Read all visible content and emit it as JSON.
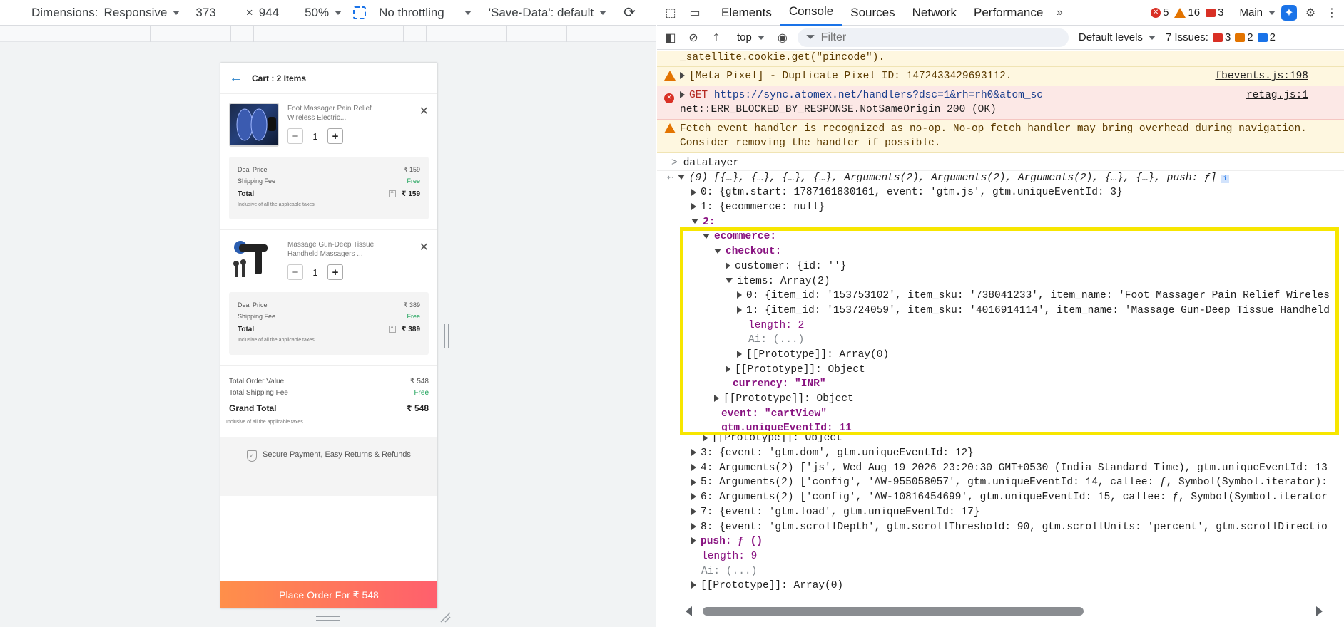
{
  "device_toolbar": {
    "dimensions_label": "Dimensions:",
    "dimensions_value": "Responsive",
    "width": "373",
    "times": "×",
    "height": "944",
    "zoom": "50%",
    "throttling": "No throttling",
    "save_data": "'Save-Data': default"
  },
  "cart": {
    "title": "Cart : 2 Items",
    "items": [
      {
        "name": "Foot Massager Pain Relief Wireless Electric...",
        "qty": "1",
        "deal_price_label": "Deal Price",
        "deal_price": "₹ 159",
        "shipping_label": "Shipping Fee",
        "shipping": "Free",
        "total_label": "Total",
        "total": "₹ 159",
        "incl": "Inclusive of all the applicable taxes"
      },
      {
        "name": "Massage Gun-Deep Tissue Handheld Massagers ...",
        "qty": "1",
        "deal_price_label": "Deal Price",
        "deal_price": "₹ 389",
        "shipping_label": "Shipping Fee",
        "shipping": "Free",
        "total_label": "Total",
        "total": "₹ 389",
        "incl": "Inclusive of all the applicable taxes"
      }
    ],
    "summary": {
      "order_value_label": "Total Order Value",
      "order_value": "₹ 548",
      "shipping_label": "Total Shipping Fee",
      "shipping": "Free",
      "grand_label": "Grand Total",
      "grand": "₹ 548",
      "incl": "Inclusive of all the applicable taxes"
    },
    "secure": "Secure Payment, Easy Returns & Refunds",
    "place_order": "Place Order For ₹ 548"
  },
  "devtools": {
    "tabs": [
      "Elements",
      "Console",
      "Sources",
      "Network",
      "Performance"
    ],
    "active_tab": "Console",
    "errors": "5",
    "warnings": "16",
    "issues_count": "3",
    "main": "Main",
    "context": "top",
    "filter_placeholder": "Filter",
    "levels": "Default levels",
    "issues_label": "7 Issues:",
    "issues_err": "3",
    "issues_warn": "2",
    "issues_info": "2"
  },
  "console": {
    "top_line": "_satellite.cookie.get(\"pincode\").",
    "meta_pixel": "[Meta Pixel] - Duplicate Pixel ID: 1472433429693112.",
    "meta_src": "fbevents.js:198",
    "get_prefix": "GET",
    "get_url": "https://sync.atomex.net/handlers?dsc=1&rh=rh0&atom_sc",
    "get_src": "retag.js:1",
    "get_error": "net::ERR_BLOCKED_BY_RESPONSE.NotSameOrigin 200 (OK)",
    "fetch_warn_1": "Fetch event handler is recognized as no-op. No-op fetch handler may bring overhead during navigation.",
    "fetch_warn_2": "Consider removing the handler if possible.",
    "input": "dataLayer",
    "summary": "(9) [{…}, {…}, {…}, {…}, Arguments(2), Arguments(2), Arguments(2), {…}, {…}, push: ƒ]",
    "l0": "0: {gtm.start: 1787161830161, event: 'gtm.js', gtm.uniqueEventId: 3}",
    "l1": "1: {ecommerce: null}",
    "l2": "2:",
    "l_ecommerce": "ecommerce:",
    "l_checkout": "checkout:",
    "l_customer": "customer: {id: ''}",
    "l_items": "items: Array(2)",
    "l_item0": "0: {item_id: '153753102', item_sku: '738041233', item_name: 'Foot Massager Pain Relief Wireles",
    "l_item1": "1: {item_id: '153724059', item_sku: '4016914114', item_name: 'Massage Gun-Deep Tissue Handheld",
    "l_length2": "length: 2",
    "l_ai": "Ai: (...)",
    "l_proto_arr": "[[Prototype]]: Array(0)",
    "l_proto_obj": "[[Prototype]]: Object",
    "l_currency": "currency: \"INR\"",
    "l_proto_obj2": "[[Prototype]]: Object",
    "l_event": "event: \"cartView\"",
    "l_uid": "gtm.uniqueEventId: 11",
    "l_proto_obj3": "[[Prototype]]: Object",
    "l3": "3: {event: 'gtm.dom', gtm.uniqueEventId: 12}",
    "l4": "4: Arguments(2) ['js', Wed Aug 19 2026 23:20:30 GMT+0530 (India Standard Time), gtm.uniqueEventId: 13",
    "l5": "5: Arguments(2) ['config', 'AW-955058057', gtm.uniqueEventId: 14, callee: ƒ, Symbol(Symbol.iterator):",
    "l6": "6: Arguments(2) ['config', 'AW-10816454699', gtm.uniqueEventId: 15, callee: ƒ, Symbol(Symbol.iterator",
    "l7": "7: {event: 'gtm.load', gtm.uniqueEventId: 17}",
    "l8": "8: {event: 'gtm.scrollDepth', gtm.scrollThreshold: 90, gtm.scrollUnits: 'percent', gtm.scrollDirectio",
    "l_push": "push: ƒ ()",
    "l_length9": "length: 9",
    "l_ai2": "Ai: (...)",
    "l_proto_final": "[[Prototype]]: Array(0)"
  },
  "colors": {
    "accent": "#1a73e8",
    "highlight": "#f7e600",
    "place_order_start": "#ff8f4a",
    "place_order_end": "#ff5f6d",
    "free": "#1fa35b"
  }
}
